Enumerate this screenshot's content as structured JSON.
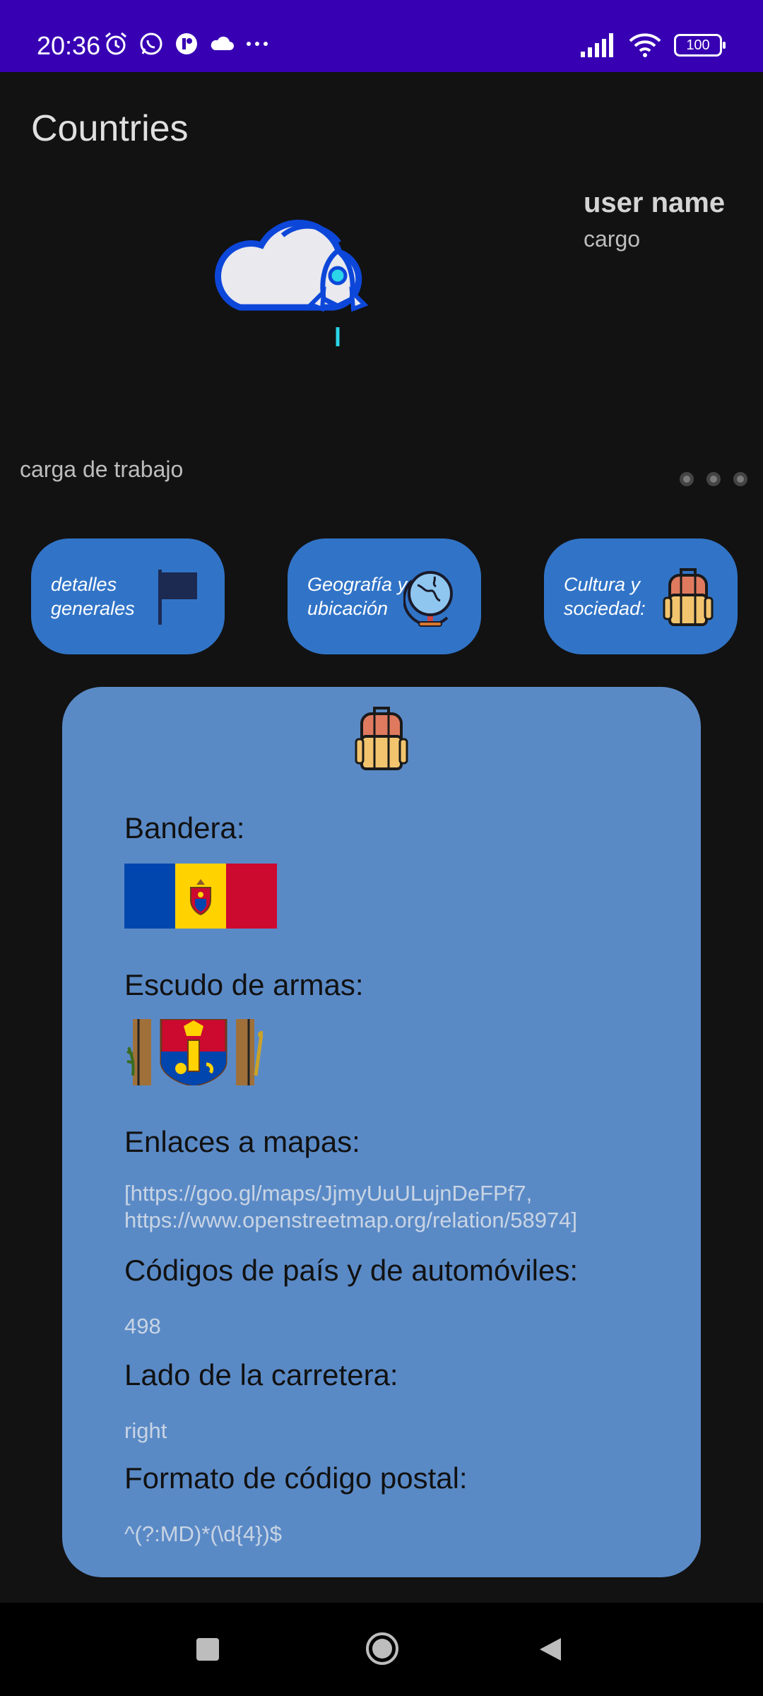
{
  "status_bar": {
    "time": "20:36",
    "battery": "100",
    "icons_left": [
      "alarm-icon",
      "whatsapp-icon",
      "app-icon",
      "cloud-icon",
      "more-icon"
    ],
    "icons_right": [
      "signal-icon",
      "wifi-icon",
      "battery-icon"
    ]
  },
  "app": {
    "title": "Countries"
  },
  "header": {
    "user_name": "user name",
    "user_role": "cargo",
    "workload": "carga de trabajo"
  },
  "categories": [
    {
      "label": "detalles generales",
      "icon": "flag-icon"
    },
    {
      "label": "Geografía y ubicación",
      "icon": "globe-icon"
    },
    {
      "label": "Cultura y sociedad:",
      "icon": "backpack-icon"
    }
  ],
  "card": {
    "icon": "backpack-icon",
    "flag_label": "Bandera:",
    "flag_colors": [
      "#0046ae",
      "#ffd200",
      "#cc092f"
    ],
    "coat_label": "Escudo de armas:",
    "maps_label": "Enlaces a mapas:",
    "maps_value": "[https://goo.gl/maps/JjmyUuULujnDeFPf7, https://www.openstreetmap.org/relation/58974]",
    "codes_label": "Códigos de país y de automóviles:",
    "codes_value": "498",
    "road_label": "Lado de la carretera:",
    "road_value": "right",
    "postal_label": "Formato de código postal:",
    "postal_value": "^(?:MD)*(\\d{4})$"
  },
  "colors": {
    "status_bar": "#3700b3",
    "background": "#121212",
    "button": "#3174c7",
    "card": "#5a8ac6"
  }
}
